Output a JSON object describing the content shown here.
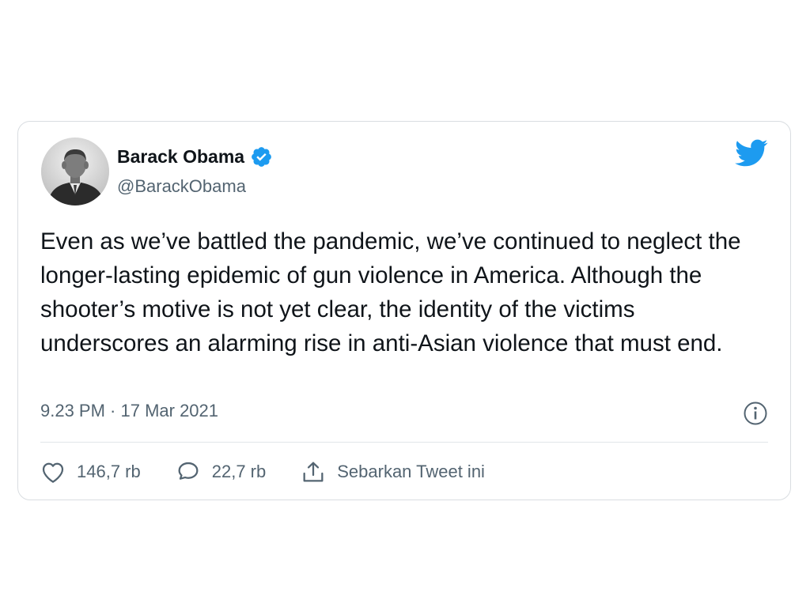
{
  "tweet": {
    "author": {
      "display_name": "Barack Obama",
      "handle": "@BarackObama",
      "verified": true
    },
    "text": "Even as we’ve battled the pandemic, we’ve continued to neglect the longer-lasting epidemic of gun violence in America. Although the shooter’s motive is not yet clear, the identity of the victims underscores an alarming rise in anti-Asian violence that must end.",
    "timestamp": "9.23 PM · 17 Mar 2021",
    "actions": {
      "like_count": "146,7 rb",
      "reply_count": "22,7 rb",
      "share_label": "Sebarkan Tweet ini"
    }
  },
  "colors": {
    "brand": "#1d9bf0",
    "text": "#0f1419",
    "secondary": "#536471",
    "border": "#d9dde1"
  },
  "icons": [
    "verified-icon",
    "twitter-bird-icon",
    "info-icon",
    "heart-icon",
    "reply-icon",
    "share-icon"
  ]
}
